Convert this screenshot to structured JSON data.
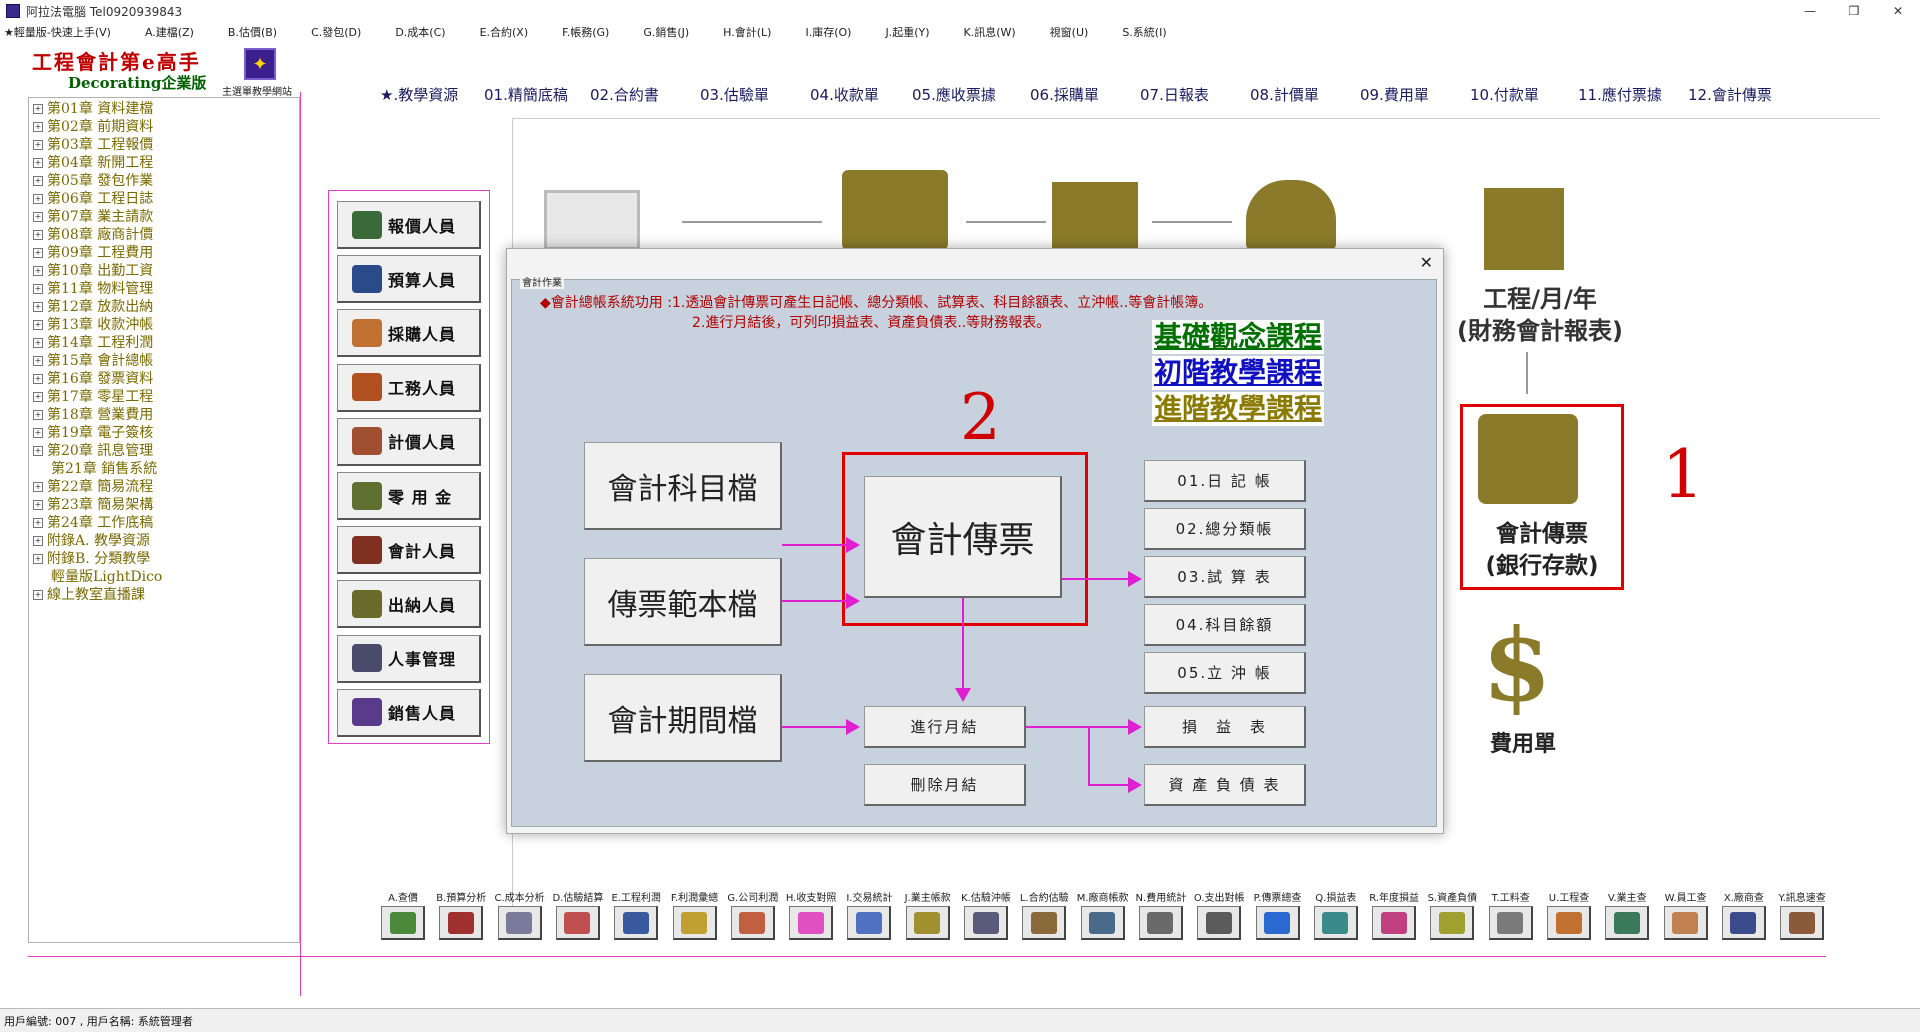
{
  "window": {
    "title": "阿拉法電腦 Tel0920939843"
  },
  "menubar": [
    "★輕量版-快速上手(V)",
    "A.建檔(Z)",
    "B.估價(B)",
    "C.發包(D)",
    "D.成本(C)",
    "E.合約(X)",
    "F.帳務(G)",
    "G.銷售(J)",
    "H.會計(L)",
    "I.庫存(O)",
    "J.起重(Y)",
    "K.訊息(W)",
    "視窗(U)",
    "S.系統(I)"
  ],
  "logo": {
    "title": "工程會計第e高手",
    "subtitle": "Decorating企業版",
    "badge_caption": "主選單教學網站"
  },
  "tree": [
    {
      "label": "第01章 資料建檔",
      "toggle": "⊞"
    },
    {
      "label": "第02章 前期資料",
      "toggle": "⊞"
    },
    {
      "label": "第03章 工程報價",
      "toggle": "⊞"
    },
    {
      "label": "第04章 新開工程",
      "toggle": "⊞"
    },
    {
      "label": "第05章 發包作業",
      "toggle": "⊞"
    },
    {
      "label": "第06章 工程日誌",
      "toggle": "⊞"
    },
    {
      "label": "第07章 業主請款",
      "toggle": "⊞"
    },
    {
      "label": "第08章 廠商計價",
      "toggle": "⊞"
    },
    {
      "label": "第09章 工程費用",
      "toggle": "⊞"
    },
    {
      "label": "第10章 出勤工資",
      "toggle": "⊞"
    },
    {
      "label": "第11章 物料管理",
      "toggle": "⊞"
    },
    {
      "label": "第12章 放款出納",
      "toggle": "⊞"
    },
    {
      "label": "第13章 收款沖帳",
      "toggle": "⊞"
    },
    {
      "label": "第14章 工程利潤",
      "toggle": "⊞"
    },
    {
      "label": "第15章 會計總帳",
      "toggle": "⊞"
    },
    {
      "label": "第16章 發票資料",
      "toggle": "⊞"
    },
    {
      "label": "第17章 零星工程",
      "toggle": "⊞"
    },
    {
      "label": "第18章 營業費用",
      "toggle": "⊞"
    },
    {
      "label": "第19章 電子簽核",
      "toggle": "⊞"
    },
    {
      "label": "第20章 訊息管理",
      "toggle": "⊞"
    },
    {
      "label": "第21章 銷售系統",
      "toggle": ""
    },
    {
      "label": "第22章 簡易流程",
      "toggle": "⊞"
    },
    {
      "label": "第23章 簡易架構",
      "toggle": "⊞"
    },
    {
      "label": "第24章 工作底稿",
      "toggle": "⊞"
    },
    {
      "label": "附錄A. 教學資源",
      "toggle": "⊞"
    },
    {
      "label": "附錄B. 分類教學",
      "toggle": "⊞"
    },
    {
      "label": "輕量版LightDico",
      "toggle": ""
    },
    {
      "label": "線上教室直播課",
      "toggle": "⊞"
    }
  ],
  "topnav": [
    "★.教學資源",
    "01.精簡底稿",
    "02.合約書",
    "03.估驗單",
    "04.收款單",
    "05.應收票據",
    "06.採購單",
    "07.日報表",
    "08.計價單",
    "09.費用單",
    "10.付款單",
    "11.應付票據",
    "12.會計傳票"
  ],
  "roles": [
    {
      "label": "報價人員",
      "color": "#3a6a3a"
    },
    {
      "label": "預算人員",
      "color": "#2a4a8a"
    },
    {
      "label": "採購人員",
      "color": "#c07030"
    },
    {
      "label": "工務人員",
      "color": "#b05020"
    },
    {
      "label": "計價人員",
      "color": "#a05030"
    },
    {
      "label": "零 用 金",
      "color": "#607030"
    },
    {
      "label": "會計人員",
      "color": "#803020"
    },
    {
      "label": "出納人員",
      "color": "#6a6a2a"
    },
    {
      "label": "人事管理",
      "color": "#4a4a6a"
    },
    {
      "label": "銷售人員",
      "color": "#5a3a8a"
    }
  ],
  "background": {
    "report_text_1": "工程/月/年",
    "report_text_2": "(財務會計報表)",
    "voucher_text_1": "會計傳票",
    "voucher_text_2": "(銀行存款)",
    "marker_1": "1",
    "dollar": "$",
    "expense_text": "費用單"
  },
  "dialog": {
    "caption": "會計作業",
    "close": "✕",
    "desc1": "◆會計總帳系統功用 :1.透過會計傳票可產生日記帳、總分類帳、試算表、科目餘額表、立沖帳..等會計帳簿。",
    "desc2": "2.進行月結後，可列印損益表、資產負債表..等財務報表。",
    "courses": [
      {
        "label": "基礎觀念課程",
        "color": "#007000"
      },
      {
        "label": "初階教學課程",
        "color": "#1010c0"
      },
      {
        "label": "進階教學課程",
        "color": "#8a7a00"
      }
    ],
    "marker_2": "2",
    "left_buttons": [
      "會計科目檔",
      "傳票範本檔",
      "會計期間檔"
    ],
    "center_button": "會計傳票",
    "ledger_buttons": [
      "01.日 記 帳",
      "02.總分類帳",
      "03.試 算 表",
      "04.科目餘額",
      "05.立 沖 帳"
    ],
    "month_close": "進行月結",
    "delete_month": "刪除月結",
    "income_statement": "損　益　表",
    "balance_sheet": "資 產 負 債 表"
  },
  "toolbar": [
    {
      "label": "A.查價",
      "color": "#4a8a3a"
    },
    {
      "label": "B.預算分析",
      "color": "#a03030"
    },
    {
      "label": "C.成本分析",
      "color": "#7a7a9a"
    },
    {
      "label": "D.估驗結算",
      "color": "#c05050"
    },
    {
      "label": "E.工程利潤",
      "color": "#3a5aa0"
    },
    {
      "label": "F.利潤彙總",
      "color": "#c0a030"
    },
    {
      "label": "G.公司利潤",
      "color": "#c06040"
    },
    {
      "label": "H.收支對照",
      "color": "#e050c0"
    },
    {
      "label": "I.交易統計",
      "color": "#5070c0"
    },
    {
      "label": "J.業主帳款",
      "color": "#a09030"
    },
    {
      "label": "K.估驗沖帳",
      "color": "#5a5a7a"
    },
    {
      "label": "L.合約估驗",
      "color": "#8a6a3a"
    },
    {
      "label": "M.廠商帳款",
      "color": "#4a6a8a"
    },
    {
      "label": "N.費用統計",
      "color": "#6a6a6a"
    },
    {
      "label": "O.支出對帳",
      "color": "#5a5a5a"
    },
    {
      "label": "P.傳票總查",
      "color": "#2a6ad0"
    },
    {
      "label": "Q.損益表",
      "color": "#3a8a8a"
    },
    {
      "label": "R.年度損益",
      "color": "#c04080"
    },
    {
      "label": "S.資產負債",
      "color": "#a0a030"
    },
    {
      "label": "T.工料查",
      "color": "#7a7a7a"
    },
    {
      "label": "U.工程查",
      "color": "#c07030"
    },
    {
      "label": "V.業主查",
      "color": "#3a7a5a"
    },
    {
      "label": "W.員工查",
      "color": "#c08050"
    },
    {
      "label": "X.廠商查",
      "color": "#3a4a8a"
    },
    {
      "label": "Y.訊息速查",
      "color": "#8a5a3a"
    }
  ],
  "status": "用戶編號: 007 , 用戶名稱: 系統管理者"
}
